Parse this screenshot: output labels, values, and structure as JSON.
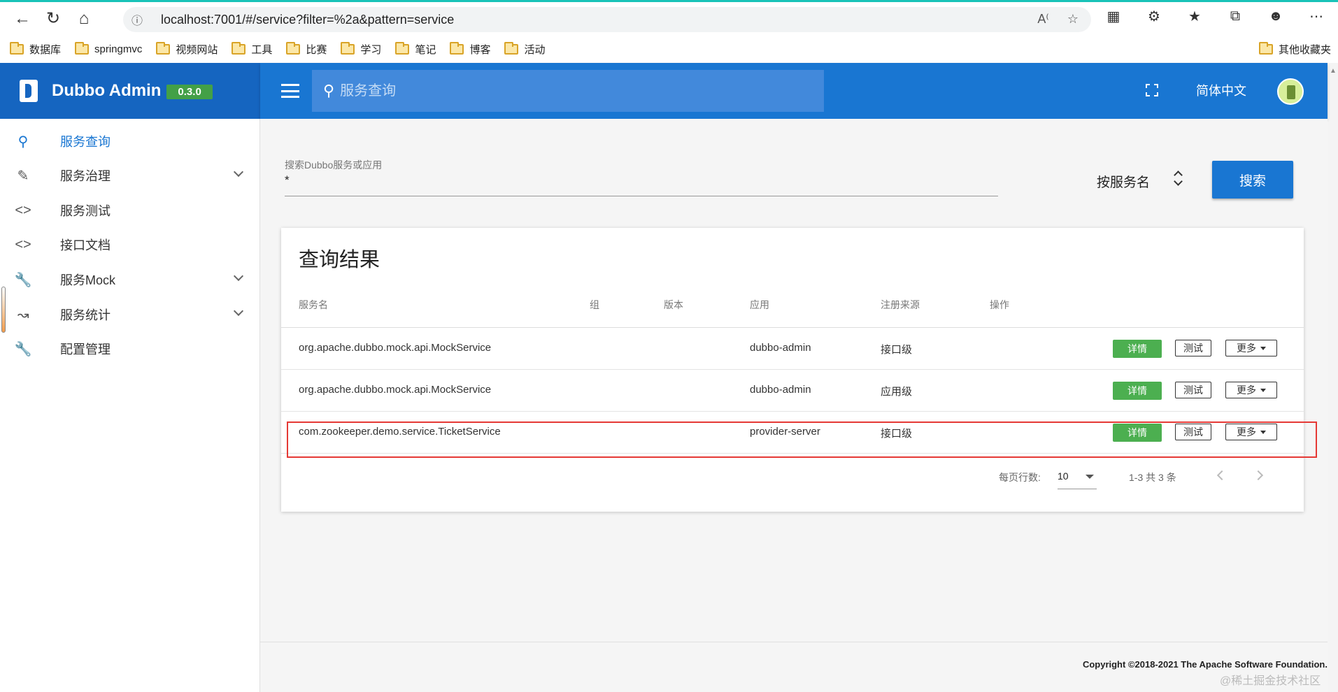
{
  "browser": {
    "url": "localhost:7001/#/service?filter=%2a&pattern=service",
    "bookmarks": [
      "数据库",
      "springmvc",
      "视频网站",
      "工具",
      "比赛",
      "学习",
      "笔记",
      "博客",
      "活动"
    ],
    "other_bookmarks": "其他收藏夹"
  },
  "app": {
    "brand": "Dubbo Admin",
    "version": "0.3.0",
    "search_placeholder": "服务查询",
    "language": "简体中文"
  },
  "sidebar": {
    "items": [
      {
        "label": "服务查询",
        "icon": "search-icon"
      },
      {
        "label": "服务治理",
        "icon": "pencil-icon"
      },
      {
        "label": "服务测试",
        "icon": "code-icon"
      },
      {
        "label": "接口文档",
        "icon": "code-icon"
      },
      {
        "label": "服务Mock",
        "icon": "wrench-icon"
      },
      {
        "label": "服务统计",
        "icon": "trend-icon"
      },
      {
        "label": "配置管理",
        "icon": "wrench-icon"
      }
    ]
  },
  "search": {
    "label": "搜索Dubbo服务或应用",
    "value": "*",
    "mode": "按服务名",
    "button": "搜索"
  },
  "results": {
    "title": "查询结果",
    "columns": [
      "服务名",
      "组",
      "版本",
      "应用",
      "注册来源",
      "操作"
    ],
    "rows": [
      {
        "service": "org.apache.dubbo.mock.api.MockService",
        "group": "",
        "version": "",
        "app": "dubbo-admin",
        "source": "接口级"
      },
      {
        "service": "org.apache.dubbo.mock.api.MockService",
        "group": "",
        "version": "",
        "app": "dubbo-admin",
        "source": "应用级"
      },
      {
        "service": "com.zookeeper.demo.service.TicketService",
        "group": "",
        "version": "",
        "app": "provider-server",
        "source": "接口级"
      }
    ],
    "actions": {
      "detail": "详情",
      "test": "测试",
      "more": "更多"
    },
    "pager": {
      "rows_label": "每页行数:",
      "rows_per_page": "10",
      "range": "1-3 共 3 条"
    }
  },
  "footer": {
    "copyright": "Copyright ©2018-2021 The Apache Software Foundation."
  },
  "watermark": "@稀土掘金技术社区",
  "colors": {
    "primary": "#1976d2",
    "header_dark": "#1565c0",
    "success": "#4caf50",
    "highlight": "#e53935"
  }
}
